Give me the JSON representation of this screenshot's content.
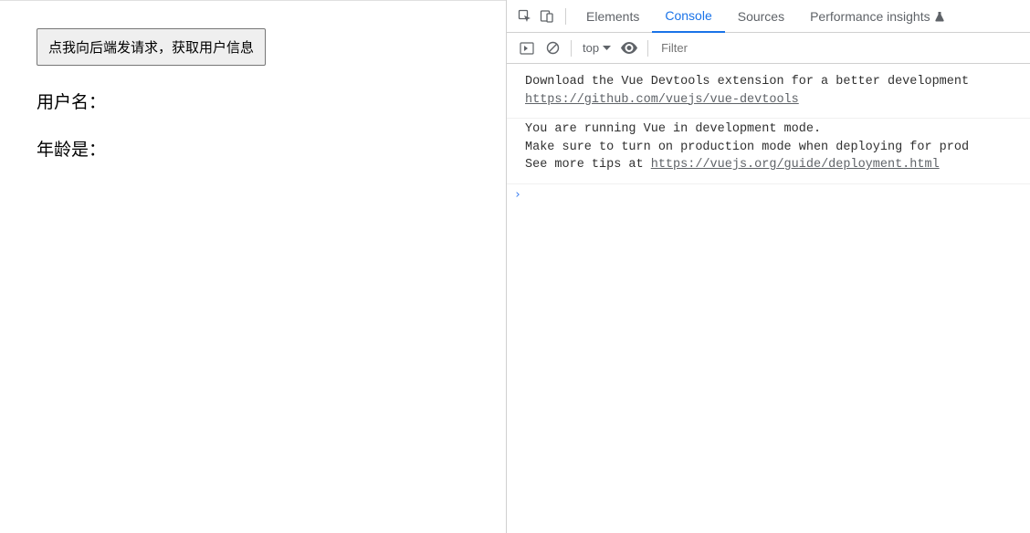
{
  "left": {
    "button_label": "点我向后端发请求，获取用户信息",
    "username_label": "用户名：",
    "age_label": "年龄是："
  },
  "devtools": {
    "tabs": {
      "elements": "Elements",
      "console": "Console",
      "sources": "Sources",
      "perf_insights": "Performance insights"
    },
    "context_label": "top",
    "filter_placeholder": "Filter",
    "messages": {
      "msg1_line1": "Download the Vue Devtools extension for a better development",
      "msg1_link": "https://github.com/vuejs/vue-devtools",
      "msg2_line1": "You are running Vue in development mode.",
      "msg2_line2": "Make sure to turn on production mode when deploying for prod",
      "msg2_line3_pre": "See more tips at ",
      "msg2_link": "https://vuejs.org/guide/deployment.html"
    },
    "prompt": "›"
  }
}
